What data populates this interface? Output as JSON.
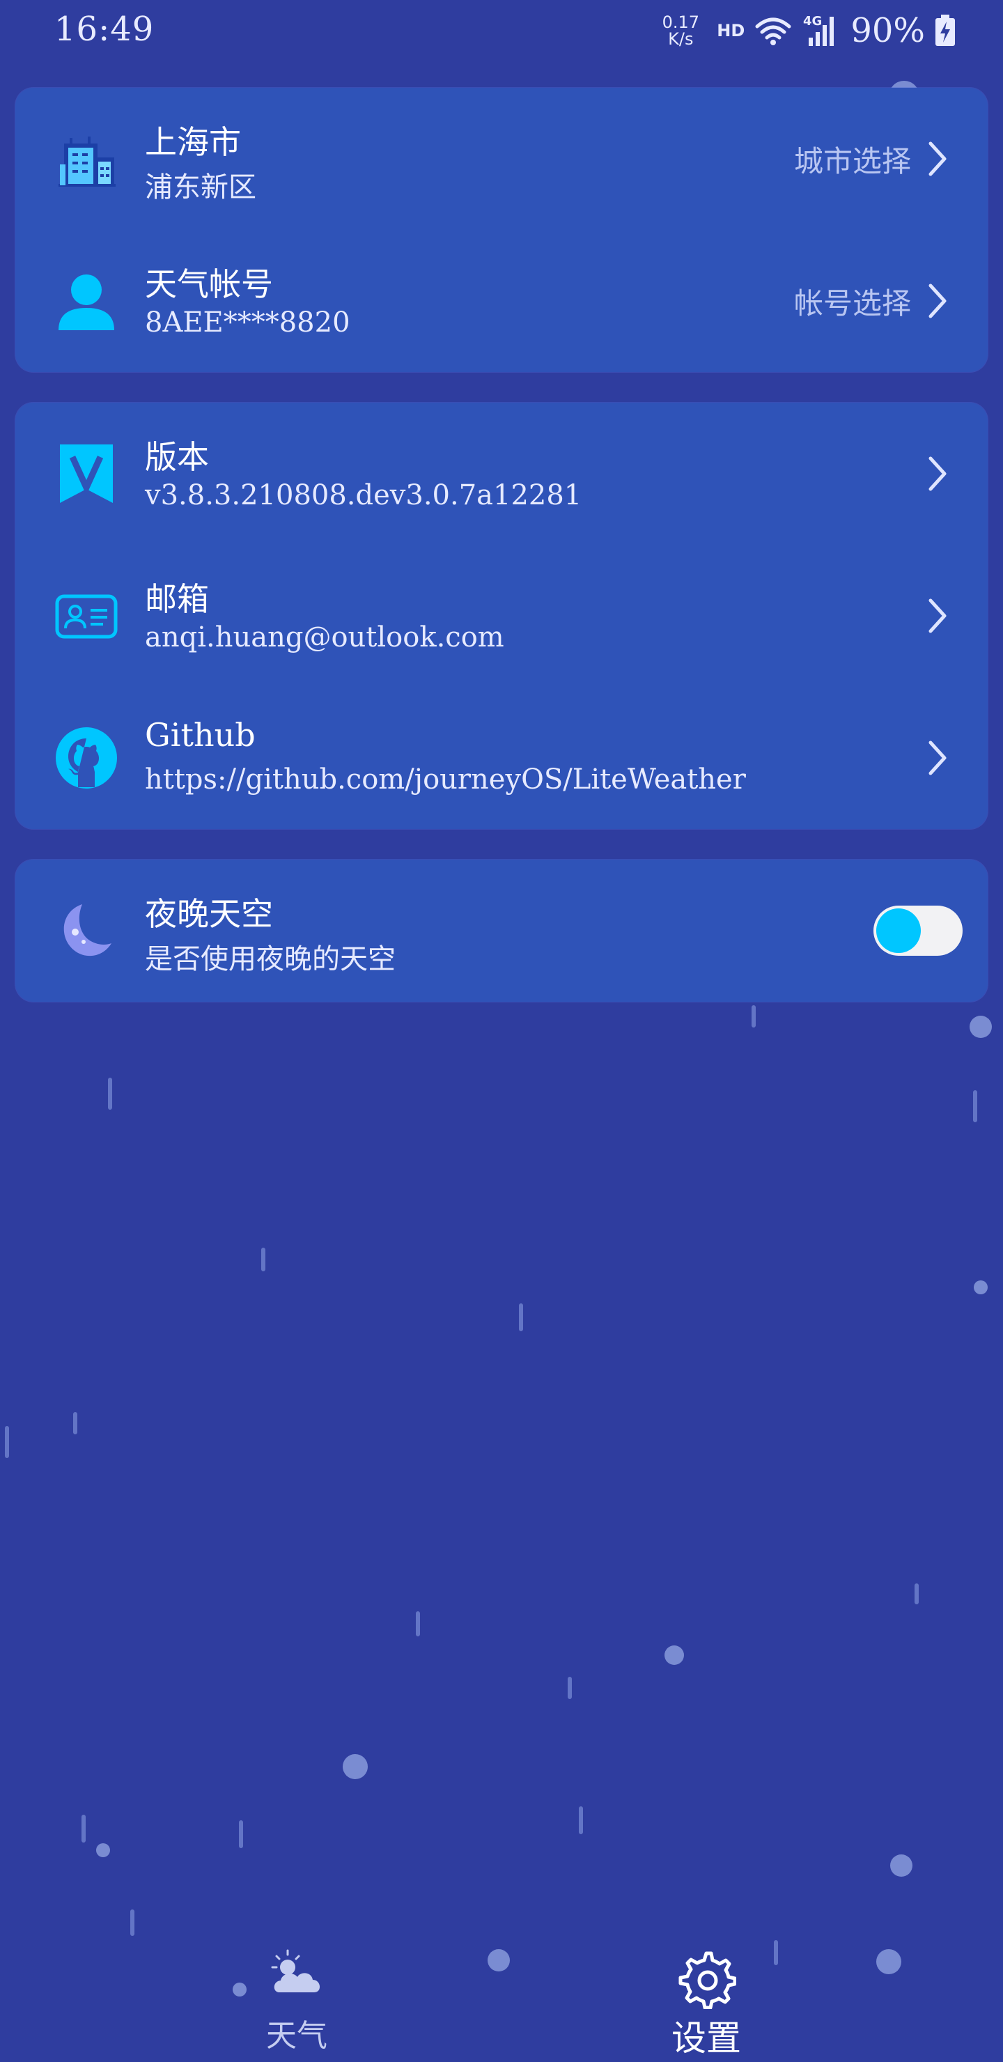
{
  "status_bar": {
    "time": "16:49",
    "net_speed_value": "0.17",
    "net_speed_unit": "K/s",
    "hd": "HD",
    "network": "4G",
    "battery": "90%"
  },
  "location_card": {
    "city": {
      "title": "上海市",
      "subtitle": "浦东新区",
      "action": "城市选择",
      "icon": "city-buildings-icon"
    },
    "account": {
      "title": "天气帐号",
      "subtitle": "8AEE****8820",
      "action": "帐号选择",
      "icon": "user-icon"
    }
  },
  "info_card": {
    "version": {
      "title": "版本",
      "subtitle": "v3.8.3.210808.dev3.0.7a12281",
      "icon": "version-v-icon"
    },
    "email": {
      "title": "邮箱",
      "subtitle": "anqi.huang@outlook.com",
      "icon": "contact-card-icon"
    },
    "github": {
      "title": "Github",
      "subtitle": "https://github.com/journeyOS/LiteWeather",
      "icon": "github-icon"
    }
  },
  "night_card": {
    "title": "夜晚天空",
    "subtitle": "是否使用夜晚的天空",
    "icon": "moon-icon",
    "enabled": true
  },
  "bottom_nav": {
    "weather": "天气",
    "settings": "设置"
  },
  "colors": {
    "background": "#2f3d9f",
    "card": "#2f53b8",
    "accent": "#00c6ff",
    "secondary_text": "#b9c6f2"
  }
}
